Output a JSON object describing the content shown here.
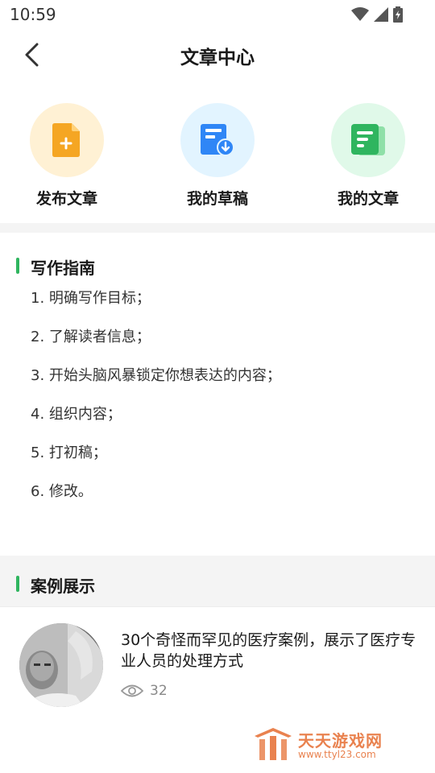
{
  "status": {
    "time": "10:59"
  },
  "header": {
    "title": "文章中心"
  },
  "actions": [
    {
      "label": "发布文章",
      "icon": "add-document-icon",
      "color": "#f5a623",
      "bg": "#fff1d4"
    },
    {
      "label": "我的草稿",
      "icon": "draft-download-icon",
      "color": "#2f86f6",
      "bg": "#e2f4ff"
    },
    {
      "label": "我的文章",
      "icon": "article-list-icon",
      "color": "#2fb55f",
      "bg": "#e0f9e9"
    }
  ],
  "guide": {
    "title": "写作指南",
    "items": [
      "1. 明确写作目标；",
      "2. 了解读者信息；",
      "3. 开始头脑风暴锁定你想表达的内容；",
      "4. 组织内容；",
      "5. 打初稿；",
      "6. 修改。"
    ]
  },
  "cases": {
    "title": "案例展示",
    "items": [
      {
        "title": "30个奇怪而罕见的医疗案例，展示了医疗专业人员的处理方式",
        "views": "32"
      }
    ]
  },
  "watermark": {
    "name": "天天游戏网",
    "url": "www.ttyl23.com"
  },
  "colors": {
    "accent": "#2fb55f",
    "band": "#f4f4f4",
    "watermark": "#e9824f"
  }
}
